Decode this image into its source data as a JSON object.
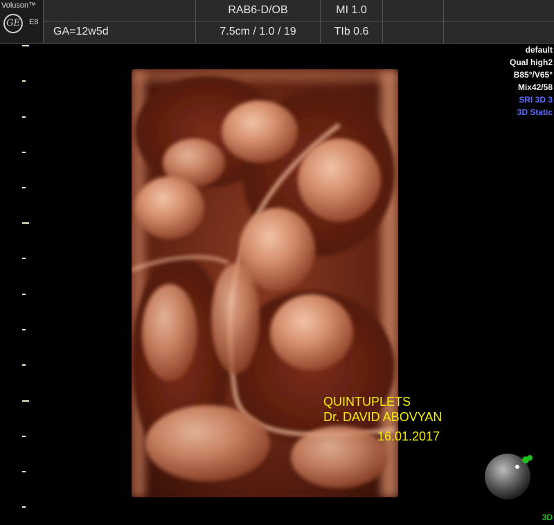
{
  "header": {
    "brand": "Voluson™",
    "model": "E8",
    "logo": "GE",
    "ga": "GA=12w5d",
    "probe": "RAB6-D/OB",
    "depth": "7.5cm / 1.0 / 19",
    "mi": "MI 1.0",
    "tib": "TIb 0.6"
  },
  "settings": {
    "items": [
      "default",
      "Qual high2",
      "B85°/V65°",
      "Mix42/58"
    ],
    "mode_items": [
      "SRI 3D 3",
      "3D Static"
    ]
  },
  "annotation": {
    "line1": "QUINTUPLETS",
    "line2": "Dr. DAVID ABOVYAN",
    "line3": "16.01.2017"
  },
  "footer_tag": "3D",
  "colors": {
    "accent_text": "#f2f000",
    "mode_blue": "#5a6bff",
    "tag_green": "#1fbf1f",
    "tissue": "#b46a4e"
  }
}
